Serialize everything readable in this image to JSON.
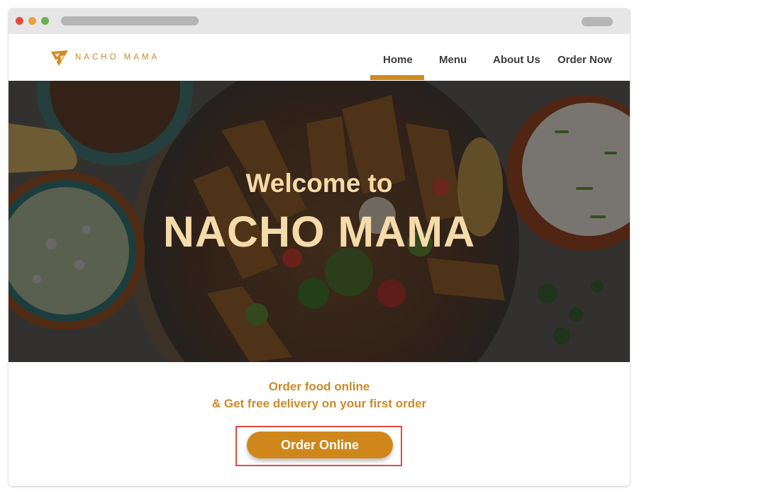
{
  "brand": {
    "name": "NACHO MAMA"
  },
  "nav": {
    "items": [
      {
        "label": "Home",
        "active": true
      },
      {
        "label": "Menu"
      },
      {
        "label": "About Us"
      },
      {
        "label": "Order Now"
      }
    ]
  },
  "hero": {
    "welcome": "Welcome to",
    "title": "NACHO MAMA"
  },
  "promo": {
    "line1": "Order food online",
    "line2": "& Get free delivery on your first order",
    "cta": "Order Online"
  },
  "colors": {
    "accent": "#cf871c",
    "accent_text": "#cc8a28",
    "hero_text": "#f5dba9",
    "highlight": "#e5483f"
  },
  "icons": [
    "nacho-logo-icon"
  ]
}
